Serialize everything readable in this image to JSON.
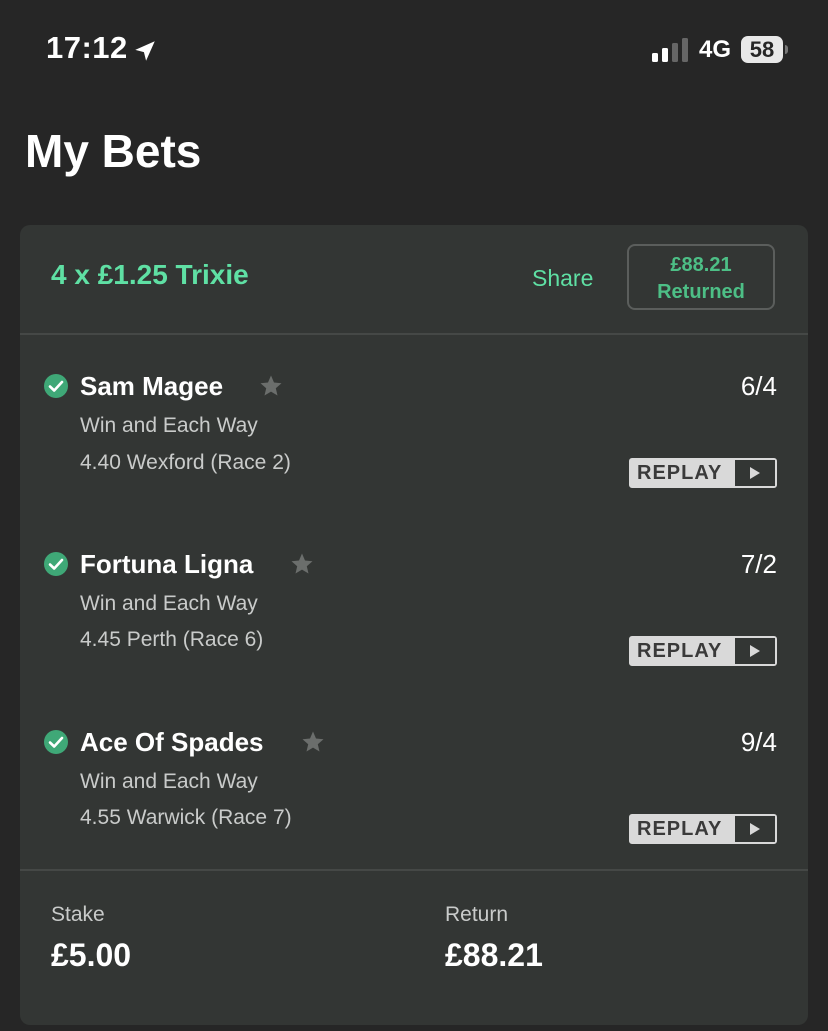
{
  "status_bar": {
    "time": "17:12",
    "network": "4G",
    "battery": "58"
  },
  "page": {
    "title": "My Bets"
  },
  "bet": {
    "title": "4 x £1.25 Trixie",
    "share_label": "Share",
    "returned_amount": "£88.21",
    "returned_label": "Returned",
    "selections": [
      {
        "name": "Sam Magee",
        "odds": "6/4",
        "market": "Win and Each Way",
        "race": "4.40 Wexford (Race 2)",
        "replay_label": "REPLAY"
      },
      {
        "name": "Fortuna Ligna",
        "odds": "7/2",
        "market": "Win and Each Way",
        "race": "4.45 Perth (Race 6)",
        "replay_label": "REPLAY"
      },
      {
        "name": "Ace Of Spades",
        "odds": "9/4",
        "market": "Win and Each Way",
        "race": "4.55 Warwick (Race 7)",
        "replay_label": "REPLAY"
      }
    ],
    "stake_label": "Stake",
    "stake_value": "£5.00",
    "return_label": "Return",
    "return_value": "£88.21"
  },
  "colors": {
    "accent_green": "#5fe0a4",
    "check_green": "#3fa877",
    "background": "#262626",
    "card": "#333634"
  },
  "icons": [
    "location-arrow-icon",
    "signal-icon",
    "battery-icon",
    "check-circle-icon",
    "star-icon",
    "play-icon"
  ]
}
